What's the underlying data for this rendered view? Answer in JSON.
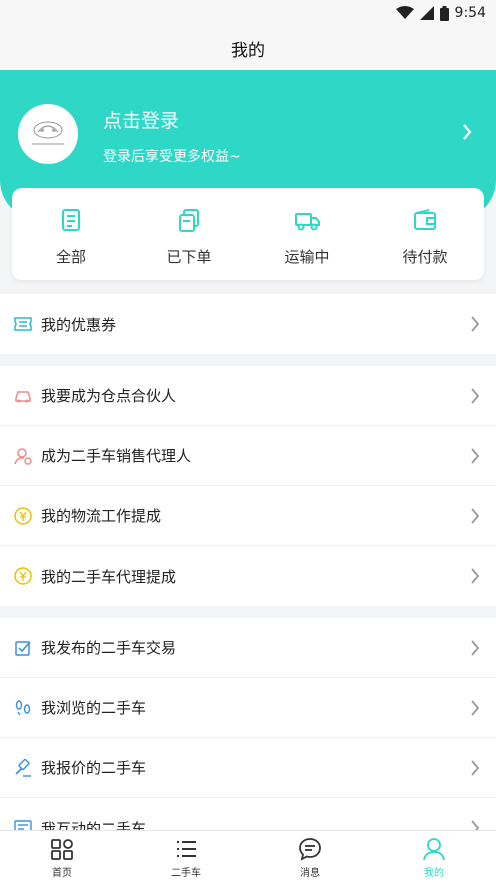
{
  "status_bar": {
    "time": "9:54",
    "icons": [
      "wifi-icon",
      "signal-icon",
      "battery-icon"
    ]
  },
  "header": {
    "title": "我的"
  },
  "profile": {
    "login_title": "点击登录",
    "login_subtitle": "登录后享受更多权益~",
    "accent_color": "#2fd8c6"
  },
  "orders": [
    {
      "label": "全部",
      "icon": "clipboard-icon"
    },
    {
      "label": "已下单",
      "icon": "copy-icon"
    },
    {
      "label": "运输中",
      "icon": "truck-icon"
    },
    {
      "label": "待付款",
      "icon": "wallet-icon"
    }
  ],
  "menu_groups": [
    [
      {
        "label": "我的优惠券",
        "icon": "coupon-icon"
      }
    ],
    [
      {
        "label": "我要成为仓点合伙人",
        "icon": "car-icon"
      },
      {
        "label": "成为二手车销售代理人",
        "icon": "user-agent-icon"
      },
      {
        "label": "我的物流工作提成",
        "icon": "yuan-coin-icon"
      },
      {
        "label": "我的二手车代理提成",
        "icon": "yuan-coin-icon"
      }
    ],
    [
      {
        "label": "我发布的二手车交易",
        "icon": "checkbox-edit-icon"
      },
      {
        "label": "我浏览的二手车",
        "icon": "footprints-icon"
      },
      {
        "label": "我报价的二手车",
        "icon": "gavel-icon"
      },
      {
        "label": "我互动的二手车",
        "icon": "chat-list-icon"
      }
    ]
  ],
  "tab_bar": [
    {
      "label": "首页",
      "icon": "home-grid-icon",
      "active": false
    },
    {
      "label": "二手车",
      "icon": "list-icon",
      "active": false
    },
    {
      "label": "消息",
      "icon": "message-icon",
      "active": false
    },
    {
      "label": "我的",
      "icon": "person-icon",
      "active": true
    }
  ]
}
